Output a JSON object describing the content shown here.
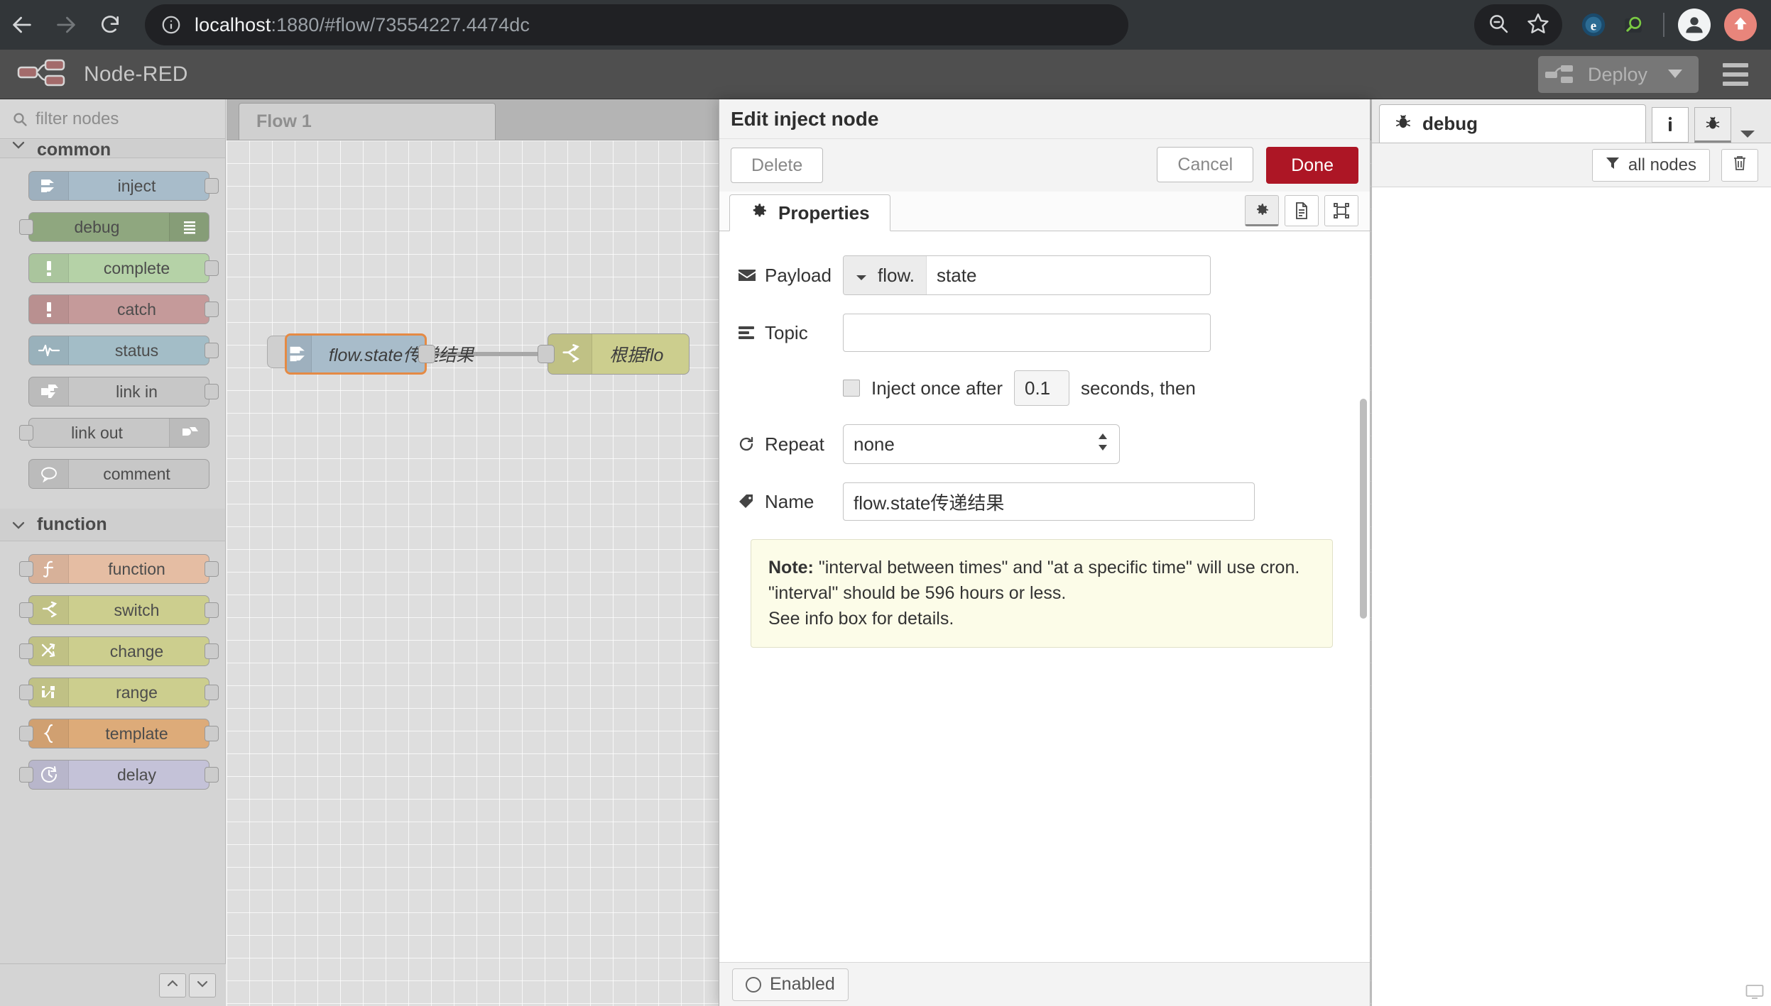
{
  "browser": {
    "url_host": "localhost",
    "url_rest": ":1880/#flow/73554227.4474dc",
    "back_icon": "back-arrow-icon",
    "forward_icon": "forward-arrow-icon",
    "reload_icon": "reload-icon",
    "info_icon": "page-info-icon",
    "search_icon": "zoom-out-search-icon",
    "bookmark_icon": "star-icon",
    "ext1_icon": "extension-e-icon",
    "ext2_icon": "extension-magnifier-icon",
    "profile_icon": "profile-avatar-icon",
    "update_icon": "update-arrow-icon"
  },
  "header": {
    "logo_icon": "node-red-logo-icon",
    "title": "Node-RED",
    "deploy_label": "Deploy",
    "deploy_icon": "deploy-node-icon",
    "deploy_caret_icon": "chevron-down-icon",
    "menu_icon": "hamburger-menu-icon"
  },
  "palette": {
    "search_placeholder": "filter nodes",
    "search_icon": "search-icon",
    "categories": [
      {
        "label": "common",
        "chevron_icon": "chevron-down-icon",
        "nodes": [
          {
            "label": "inject",
            "icon": "inject-arrow-icon",
            "color": "#a8bcca",
            "icon_color": "#9aafbf",
            "port_in": false,
            "port_out": true,
            "icon_side": "left"
          },
          {
            "label": "debug",
            "icon": "debug-lines-icon",
            "color": "#8fa77f",
            "icon_color": "#86a074",
            "port_in": true,
            "port_out": false,
            "icon_side": "right"
          },
          {
            "label": "complete",
            "icon": "exclamation-icon",
            "color": "#b5d2a7",
            "icon_color": "#a9c99a",
            "port_in": false,
            "port_out": true,
            "icon_side": "left"
          },
          {
            "label": "catch",
            "icon": "exclamation-icon",
            "color": "#c59a9a",
            "icon_color": "#bb8d8d",
            "port_in": false,
            "port_out": true,
            "icon_side": "left"
          },
          {
            "label": "status",
            "icon": "pulse-icon",
            "color": "#a3bdc7",
            "icon_color": "#95b2bd",
            "port_in": false,
            "port_out": true,
            "icon_side": "left"
          },
          {
            "label": "link in",
            "icon": "link-in-icon",
            "color": "#c7c7c7",
            "icon_color": "#bcbcbc",
            "port_in": false,
            "port_out": true,
            "icon_side": "left"
          },
          {
            "label": "link out",
            "icon": "link-out-icon",
            "color": "#c7c7c7",
            "icon_color": "#bcbcbc",
            "port_in": true,
            "port_out": false,
            "icon_side": "right"
          },
          {
            "label": "comment",
            "icon": "comment-bubble-icon",
            "color": "#c7c7c7",
            "icon_color": "#bcbcbc",
            "port_in": false,
            "port_out": false,
            "icon_side": "left"
          }
        ]
      },
      {
        "label": "function",
        "chevron_icon": "chevron-down-icon",
        "nodes": [
          {
            "label": "function",
            "icon": "function-f-icon",
            "color": "#e5bda3",
            "icon_color": "#dcb195",
            "port_in": true,
            "port_out": true,
            "icon_side": "left"
          },
          {
            "label": "switch",
            "icon": "switch-fork-icon",
            "color": "#ccce8e",
            "icon_color": "#c3c681",
            "port_in": true,
            "port_out": true,
            "icon_side": "left"
          },
          {
            "label": "change",
            "icon": "change-swap-icon",
            "color": "#ccce8e",
            "icon_color": "#c3c681",
            "port_in": true,
            "port_out": true,
            "icon_side": "left"
          },
          {
            "label": "range",
            "icon": "range-icon",
            "color": "#ccce8e",
            "icon_color": "#c3c681",
            "port_in": true,
            "port_out": true,
            "icon_side": "left"
          },
          {
            "label": "template",
            "icon": "brace-icon",
            "color": "#ddab79",
            "icon_color": "#d4a06c",
            "port_in": true,
            "port_out": true,
            "icon_side": "left"
          },
          {
            "label": "delay",
            "icon": "clock-icon",
            "color": "#c4c2d8",
            "icon_color": "#b9b7cf",
            "port_in": true,
            "port_out": true,
            "icon_side": "left"
          }
        ]
      }
    ],
    "footer": {
      "collapse_icon": "chevron-up-icon",
      "expand_icon": "chevron-down-icon"
    }
  },
  "workspace": {
    "tab_label": "Flow 1",
    "nodes": [
      {
        "label": "flow.state传递结果",
        "icon": "inject-arrow-icon",
        "color": "#a8bcca",
        "selected": true
      },
      {
        "label": "根据flo",
        "icon": "switch-fork-icon",
        "color": "#ccce8e",
        "selected": false
      }
    ]
  },
  "edit_dialog": {
    "title": "Edit inject node",
    "delete_label": "Delete",
    "cancel_label": "Cancel",
    "done_label": "Done",
    "tab_label": "Properties",
    "tab_icon": "gear-icon",
    "icon_buttons": [
      {
        "name": "settings-gear-icon",
        "active": true
      },
      {
        "name": "description-doc-icon",
        "active": false
      },
      {
        "name": "appearance-icon",
        "active": false
      }
    ],
    "payload": {
      "label": "Payload",
      "icon": "envelope-icon",
      "type": "flow.",
      "type_caret_icon": "caret-down-icon",
      "value": "state"
    },
    "topic": {
      "label": "Topic",
      "icon": "list-lines-icon",
      "value": "",
      "placeholder": ""
    },
    "inject_once": {
      "label": "Inject once after",
      "checked": false,
      "delay": "0.1",
      "suffix": "seconds, then"
    },
    "repeat": {
      "label": "Repeat",
      "icon": "refresh-icon",
      "value": "none",
      "spinner_icon": "spinner-up-down-icon"
    },
    "name": {
      "label": "Name",
      "icon": "tag-icon",
      "value": "flow.state传递结果"
    },
    "note": {
      "prefix": "Note:",
      "line1": " \"interval between times\" and \"at a specific time\" will use cron.",
      "line2": "\"interval\" should be 596 hours or less.",
      "line3": "See info box for details."
    },
    "footer": {
      "enabled_label": "Enabled",
      "enabled_icon": "circle-toggle-icon"
    }
  },
  "debug_sidebar": {
    "tab_label": "debug",
    "tab_icon": "bug-icon",
    "info_button_icon": "info-i-icon",
    "bug_button_icon": "bug-icon",
    "caret_icon": "chevron-down-icon",
    "filter_label": "all nodes",
    "filter_icon": "funnel-icon",
    "trash_icon": "trash-icon",
    "status_icon": "monitor-icon"
  }
}
